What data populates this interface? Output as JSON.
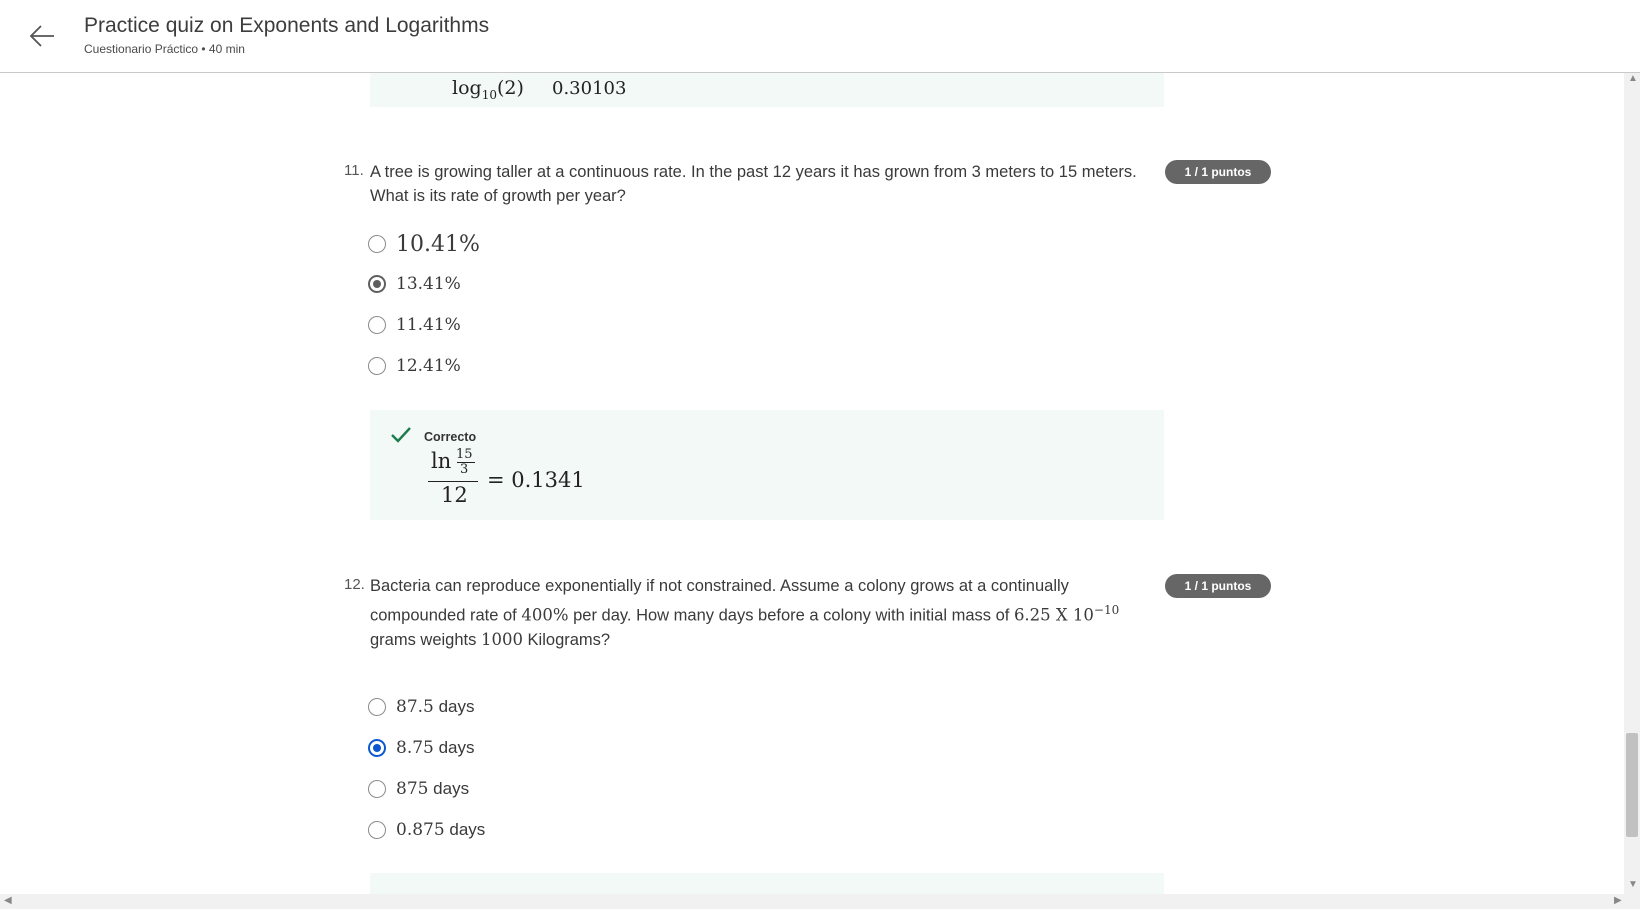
{
  "header": {
    "title": "Practice quiz on Exponents and Logarithms",
    "subtitle": "Cuestionario Práctico • 40 min"
  },
  "prev_feedback": {
    "log_expr": "log",
    "log_base": "10",
    "log_arg": "(2)",
    "value": "0.30103"
  },
  "questions": [
    {
      "number": "11.",
      "text_line1": "A tree is growing taller at a continuous rate. In the past 12 years it has grown from 3 meters to 15 meters.",
      "text_line2": "What is its rate of growth per year?",
      "points": "1 / 1 puntos",
      "options": [
        "10.41%",
        "13.41%",
        "11.41%",
        "12.41%"
      ],
      "selected": "13.41%",
      "feedback": {
        "status": "Correcto",
        "ln": "ln",
        "num": "15",
        "den": "3",
        "divisor": "12",
        "result": "= 0.1341"
      }
    },
    {
      "number": "12.",
      "text_line1": "Bacteria can reproduce exponentially if not constrained. Assume a colony grows at a continually",
      "text_line2a": "compounded rate of ",
      "text_line2b": "400%",
      "text_line2c": " per day. How many days before a colony with initial mass of ",
      "text_line2d": "6.25 X 10",
      "text_line2e": "−10",
      "text_line3a": "grams weights ",
      "text_line3b": "1000",
      "text_line3c": " Kilograms?",
      "points": "1 / 1 puntos",
      "options": [
        "87.5",
        "8.75",
        "875",
        "0.875"
      ],
      "option_unit": " days",
      "selected": "8.75"
    }
  ],
  "colors": {
    "feedback_bg": "#f3f9f6",
    "check_green": "#1a7d4a",
    "badge_bg": "#666666",
    "selected_blue": "#0b57d0"
  }
}
